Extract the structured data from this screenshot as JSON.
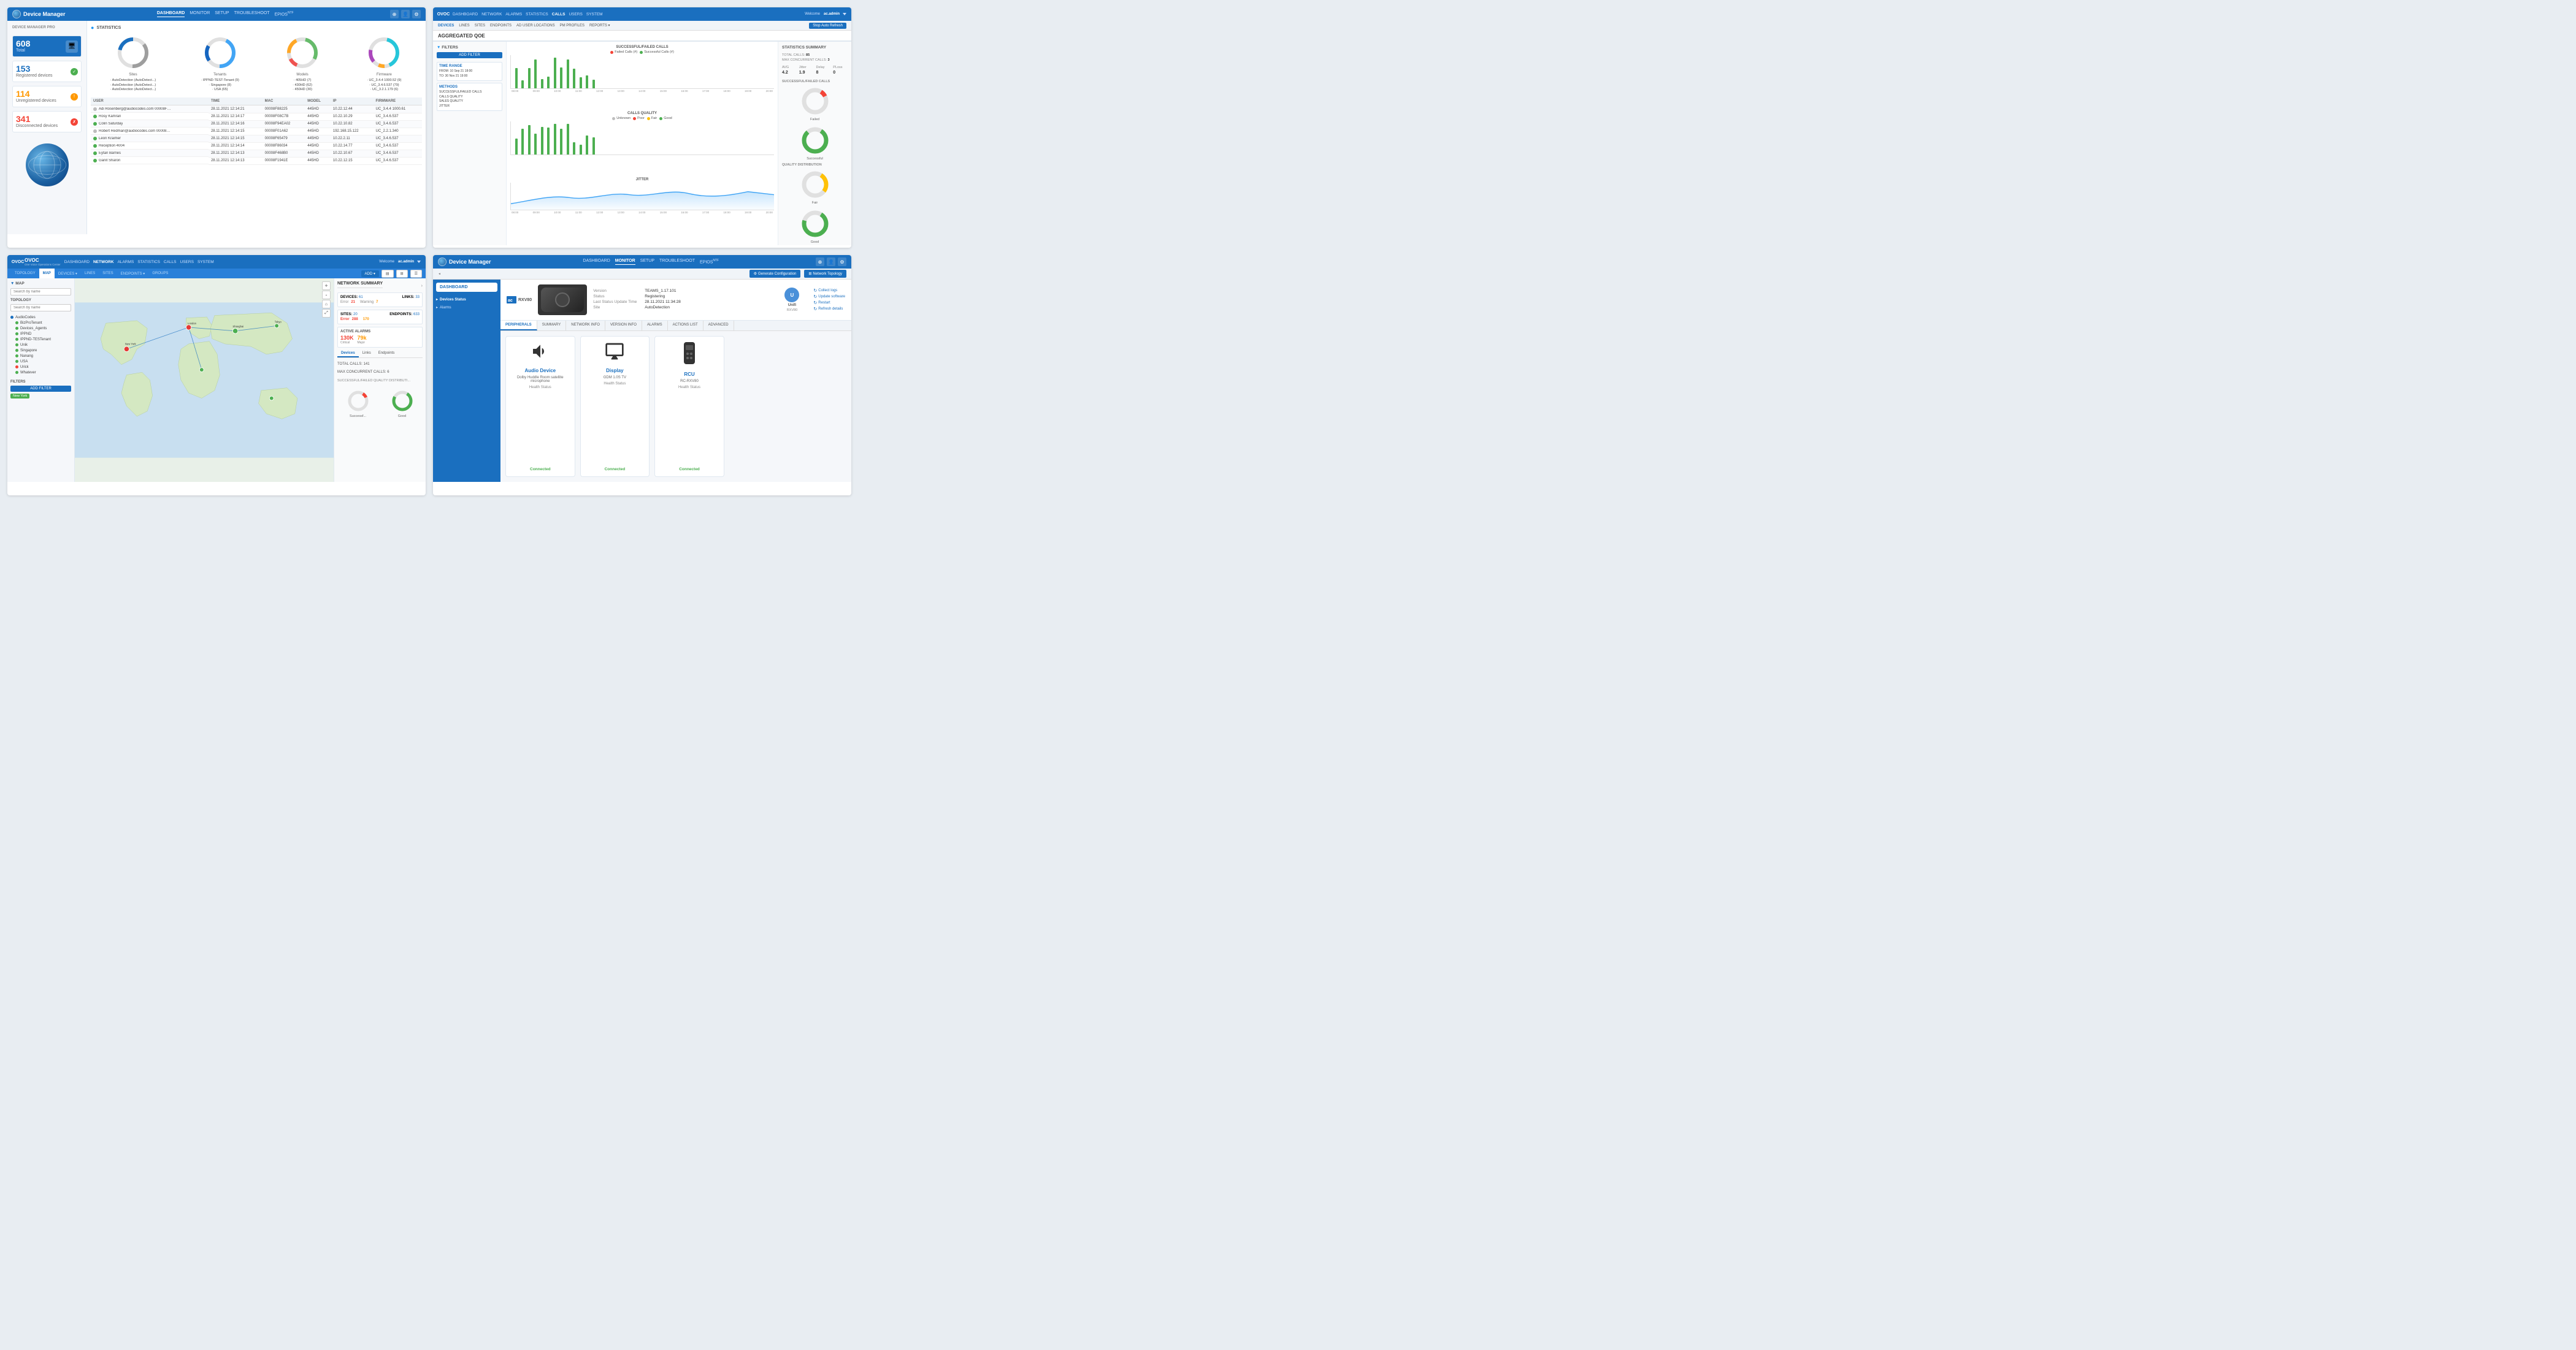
{
  "panel1": {
    "brand": "Device Manager",
    "nav": [
      "DASHBOARD",
      "MONITOR",
      "SETUP",
      "TROUBLESHOOT",
      "EPIOS"
    ],
    "sidebar": {
      "title": "DEVICE MANAGER PRO",
      "total_label": "Total",
      "total_num": "608",
      "registered_num": "153",
      "registered_label": "Registered devices",
      "unregistered_num": "114",
      "unregistered_label": "Unregistered devices",
      "disconnected_num": "341",
      "disconnected_label": "Disconnected devices"
    },
    "stats_title": "STATISTICS",
    "circles": [
      {
        "label": "Sites"
      },
      {
        "label": "Tenants"
      },
      {
        "label": "Models"
      },
      {
        "label": "Firmware"
      }
    ],
    "table_headers": [
      "USER",
      "TIME",
      "MAC",
      "MODEL",
      "IP",
      "FIRMWARE"
    ],
    "table_rows": [
      {
        "name": "Adi Rosenberg@audiocodes.com 00008F0ec23",
        "time": "28.11.2021 12:14:21",
        "mac": "00008F88225",
        "model": "445HD",
        "ip": "10.22.12.44",
        "fw": "UC_3.4.4 1000.61",
        "status": "grey"
      },
      {
        "name": "Rosy Kamran",
        "time": "28.11.2021 12:14:17",
        "mac": "00008F08C7B",
        "model": "445HD",
        "ip": "10.22.10.29",
        "fw": "UC_3.4.6.537",
        "status": "green"
      },
      {
        "name": "Colin Saturday",
        "time": "28.11.2021 12:14:16",
        "mac": "00008F94EA02",
        "model": "445HD",
        "ip": "10.22.10.82",
        "fw": "UC_3.4.6.537",
        "status": "green"
      },
      {
        "name": "Robert Redman@audiocodes.com 00008F014c02",
        "time": "28.11.2021 12:14:15",
        "mac": "00008F01A62",
        "model": "445HD",
        "ip": "192.168.15.122",
        "fw": "UC_2.2.1.340",
        "status": "grey"
      },
      {
        "name": "Leon Kraimer",
        "time": "28.11.2021 12:14:15",
        "mac": "00008F65479",
        "model": "445HD",
        "ip": "10.22.2.11",
        "fw": "UC_3.4.6.537",
        "status": "green"
      },
      {
        "name": "Reception 4004",
        "time": "28.11.2021 12:14:14",
        "mac": "00008F86034",
        "model": "445HD",
        "ip": "10.22.14.77",
        "fw": "UC_3.4.6.537",
        "status": "green"
      },
      {
        "name": "Eytan Barnes",
        "time": "28.11.2021 12:14:13",
        "mac": "00008F468B0",
        "model": "445HD",
        "ip": "10.22.10.67",
        "fw": "UC_3.4.6.537",
        "status": "green"
      },
      {
        "name": "Ganit Sharon",
        "time": "28.11.2021 12:14:13",
        "mac": "00008F1941E",
        "model": "445HD",
        "ip": "10.22.12.15",
        "fw": "UC_3.4.6.537",
        "status": "green"
      }
    ]
  },
  "panel2": {
    "title": "AGGREGATED QOE",
    "nav": [
      "DEVICES",
      "LINES",
      "SITES",
      "ENDPOINTS",
      "AD USER LOCATIONS",
      "PM PROFILES",
      "REPORTS"
    ],
    "ovoc_nav": [
      "DASHBOARD",
      "NETWORK",
      "ALARMS",
      "STATISTICS",
      "CALLS",
      "USERS",
      "SYSTEM"
    ],
    "auto_refresh": "Stop Auto Refresh",
    "filter_title": "FILTERS",
    "add_filter": "ADD FILTER",
    "filter1": {
      "header": "TIME RANGE",
      "val": "FROM: 10 Sep 21 18:00\nTO: 30 Nov 21 19:00"
    },
    "filter2": {
      "header": "METHODS",
      "val": "SUCCESSFUL/FAILED CALLS\nCALLS QUALITY\nSALES QUALITY\nJITTER"
    },
    "charts": {
      "title1": "SUCCESSFUL/FAILED CALLS",
      "title2": "CALLS QUALITY",
      "title3": "JITTER"
    },
    "stats": {
      "title": "STATISTICS SUMMARY",
      "total_calls": "85",
      "max_concurrent": "3",
      "avg": "4.2",
      "jitter": "1.9",
      "delay": "8",
      "ploss": "0"
    },
    "quality_labels": [
      "Failed",
      "Successful",
      "Fair",
      "Good"
    ]
  },
  "panel3": {
    "brand": "OVOC",
    "sub_brand": "One Voice Operations Center",
    "nav": [
      "DASHBOARD",
      "NETWORK",
      "ALARMS",
      "STATISTICS",
      "CALLS",
      "USERS",
      "SYSTEM"
    ],
    "tab_items": [
      "TOPOLOGY",
      "MAP",
      "DEVICES",
      "LINES",
      "SITES",
      "ENDPOINTS",
      "GROUPS"
    ],
    "add_button": "ADD",
    "sidebar_title": "TOPOLOGY",
    "search_placeholder": "Search by name",
    "tree_items": [
      "AudioCodes",
      "BizProTenant",
      "Devices_Agents",
      "IPPND",
      "IPPND-TESTenant",
      "Unik",
      "Singapore",
      "Nanang",
      "USA",
      "Urick",
      "Whatever"
    ],
    "filters_title": "FILTERS",
    "add_filter": "ADD FILTER",
    "filter_tag": "New York",
    "network_summary": {
      "title": "NETWORK SUMMARY",
      "devices_label": "DEVICES:",
      "devices_val": "61",
      "links_label": "LINKS:",
      "links_val": "33",
      "row1": {
        "label": "Error",
        "val": "21",
        "color": "red",
        "label2": "Warning",
        "val2": "7",
        "color2": "orange"
      },
      "sites_label": "SITES:",
      "sites_val": "20",
      "endpoints_label": "ENDPOINTS:",
      "endpoints_val": "633",
      "alarms_title": "ACTIVE ALARMS",
      "alarm1": "130K",
      "alarm2": "79k",
      "total_calls": "TOTAL CALLS: 141",
      "max_concurrent": "MAX CONCURRENT CALLS: 6"
    }
  },
  "panel4": {
    "brand": "Device Manager",
    "nav": [
      "DASHBOARD",
      "MONITOR",
      "SETUP",
      "TROUBLESHOOT",
      "EPIOS"
    ],
    "toolbar": {
      "generate_config": "Generate Configuration",
      "network_topology": "Network Topology"
    },
    "sidebar_btn": "DASHBOARD",
    "sidebar_nav": [
      "Devices Status",
      "Alarms"
    ],
    "device": {
      "model": "RXV80",
      "version": "TEAMS_1.17.101",
      "status": "Registering",
      "last_update": "28.11.2021 11:34:28",
      "site": "AutoDetection"
    },
    "user": {
      "initial": "U",
      "name": "Unifi",
      "sub": "RXV80"
    },
    "actions": [
      "Collect logs",
      "Update software",
      "Restart",
      "Refresh details"
    ],
    "tabs": [
      "PERIPHERALS",
      "SUMMARY",
      "NETWORK INFO",
      "VERSION INFO",
      "ALARMS",
      "ACTIONS LIST",
      "ADVANCED"
    ],
    "peripherals": [
      {
        "name": "Audio Device",
        "sub": "Dolby Huddle Room satellite microphone",
        "status": "Health Status",
        "connected": "Connected",
        "icon": "🔊"
      },
      {
        "name": "Display",
        "sub": "GDM 1.0S TV",
        "status": "Health Status",
        "connected": "Connected",
        "icon": "🖥"
      },
      {
        "name": "RCU",
        "sub": "RC-RXV80",
        "status": "Health Status",
        "connected": "Connected",
        "icon": "📱"
      }
    ]
  }
}
